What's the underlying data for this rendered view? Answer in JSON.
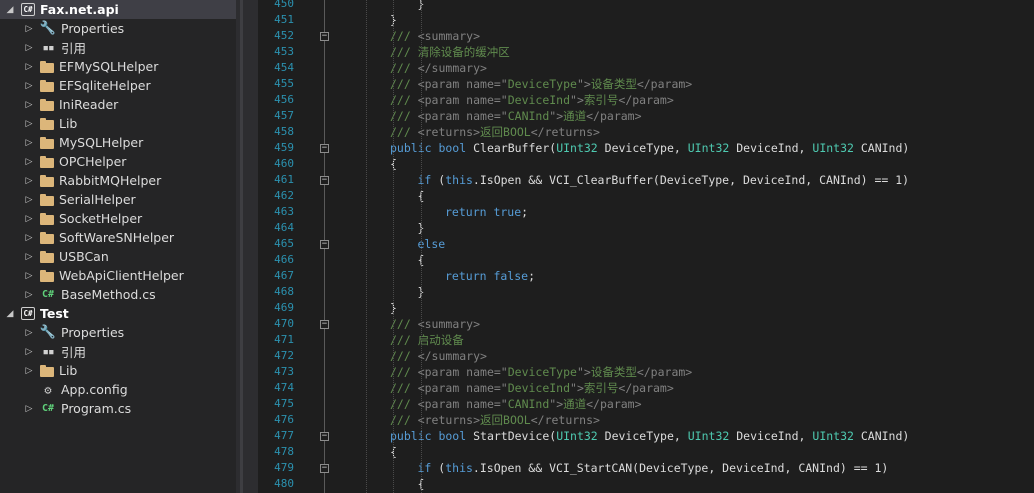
{
  "solution_tree": [
    {
      "label": "Fax.net.api",
      "kind": "project",
      "level": 0,
      "arrow": "open",
      "selected": true
    },
    {
      "label": "Properties",
      "kind": "properties",
      "level": 1,
      "arrow": "closed"
    },
    {
      "label": "引用",
      "kind": "references",
      "level": 1,
      "arrow": "closed"
    },
    {
      "label": "EFMySQLHelper",
      "kind": "folder",
      "level": 1,
      "arrow": "closed"
    },
    {
      "label": "EFSqliteHelper",
      "kind": "folder",
      "level": 1,
      "arrow": "closed"
    },
    {
      "label": "IniReader",
      "kind": "folder",
      "level": 1,
      "arrow": "closed"
    },
    {
      "label": "Lib",
      "kind": "folder",
      "level": 1,
      "arrow": "closed"
    },
    {
      "label": "MySQLHelper",
      "kind": "folder",
      "level": 1,
      "arrow": "closed"
    },
    {
      "label": "OPCHelper",
      "kind": "folder",
      "level": 1,
      "arrow": "closed"
    },
    {
      "label": "RabbitMQHelper",
      "kind": "folder",
      "level": 1,
      "arrow": "closed"
    },
    {
      "label": "SerialHelper",
      "kind": "folder",
      "level": 1,
      "arrow": "closed"
    },
    {
      "label": "SocketHelper",
      "kind": "folder",
      "level": 1,
      "arrow": "closed"
    },
    {
      "label": "SoftWareSNHelper",
      "kind": "folder",
      "level": 1,
      "arrow": "closed"
    },
    {
      "label": "USBCan",
      "kind": "folder",
      "level": 1,
      "arrow": "closed"
    },
    {
      "label": "WebApiClientHelper",
      "kind": "folder",
      "level": 1,
      "arrow": "closed"
    },
    {
      "label": "BaseMethod.cs",
      "kind": "csfile",
      "level": 1,
      "arrow": "closed"
    },
    {
      "label": "Test",
      "kind": "project",
      "level": 0,
      "arrow": "open"
    },
    {
      "label": "Properties",
      "kind": "properties",
      "level": 1,
      "arrow": "closed"
    },
    {
      "label": "引用",
      "kind": "references",
      "level": 1,
      "arrow": "closed"
    },
    {
      "label": "Lib",
      "kind": "folder",
      "level": 1,
      "arrow": "closed"
    },
    {
      "label": "App.config",
      "kind": "config",
      "level": 1,
      "arrow": "none"
    },
    {
      "label": "Program.cs",
      "kind": "csfile",
      "level": 1,
      "arrow": "closed"
    }
  ],
  "icon_names": {
    "project": "csharp-project-icon",
    "properties": "wrench-icon",
    "references": "references-icon",
    "folder": "folder-icon",
    "csfile": "csharp-file-icon",
    "config": "config-file-icon"
  },
  "icon_glyphs": {
    "project": "C#",
    "properties": "🔧",
    "references": "▪▪",
    "folder": "",
    "csfile": "C#",
    "config": "⚙"
  },
  "colors": {
    "line_number": "#2b91af",
    "keyword": "#569cd6",
    "type": "#4ec9b0",
    "comment": "#57a64a",
    "xml_doc_tag": "#808080"
  },
  "editor_lines": [
    {
      "n": "450",
      "indent": 3,
      "tokens": [
        [
          "pl",
          "}"
        ]
      ]
    },
    {
      "n": "451",
      "indent": 2,
      "tokens": [
        [
          "pl",
          "}"
        ]
      ]
    },
    {
      "n": "452",
      "indent": 2,
      "tokens": [
        [
          "dc",
          "/// "
        ],
        [
          "tag",
          "<summary>"
        ]
      ]
    },
    {
      "n": "453",
      "indent": 2,
      "tokens": [
        [
          "dc",
          "/// 清除设备的缓冲区"
        ]
      ]
    },
    {
      "n": "454",
      "indent": 2,
      "tokens": [
        [
          "dc",
          "/// "
        ],
        [
          "tag",
          "</summary>"
        ]
      ]
    },
    {
      "n": "455",
      "indent": 2,
      "tokens": [
        [
          "dc",
          "/// "
        ],
        [
          "tag",
          "<param name=\""
        ],
        [
          "dc",
          "DeviceType"
        ],
        [
          "tag",
          "\">"
        ],
        [
          "dc",
          "设备类型"
        ],
        [
          "tag",
          "</param>"
        ]
      ]
    },
    {
      "n": "456",
      "indent": 2,
      "tokens": [
        [
          "dc",
          "/// "
        ],
        [
          "tag",
          "<param name=\""
        ],
        [
          "dc",
          "DeviceInd"
        ],
        [
          "tag",
          "\">"
        ],
        [
          "dc",
          "索引号"
        ],
        [
          "tag",
          "</param>"
        ]
      ]
    },
    {
      "n": "457",
      "indent": 2,
      "tokens": [
        [
          "dc",
          "/// "
        ],
        [
          "tag",
          "<param name=\""
        ],
        [
          "dc",
          "CANInd"
        ],
        [
          "tag",
          "\">"
        ],
        [
          "dc",
          "通道"
        ],
        [
          "tag",
          "</param>"
        ]
      ]
    },
    {
      "n": "458",
      "indent": 2,
      "tokens": [
        [
          "dc",
          "/// "
        ],
        [
          "tag",
          "<returns>"
        ],
        [
          "dc",
          "返回BOOL"
        ],
        [
          "tag",
          "</returns>"
        ]
      ]
    },
    {
      "n": "459",
      "indent": 2,
      "tokens": [
        [
          "kw",
          "public bool "
        ],
        [
          "pl",
          "ClearBuffer("
        ],
        [
          "ty",
          "UInt32"
        ],
        [
          "pl",
          " DeviceType, "
        ],
        [
          "ty",
          "UInt32"
        ],
        [
          "pl",
          " DeviceInd, "
        ],
        [
          "ty",
          "UInt32"
        ],
        [
          "pl",
          " CANInd)"
        ]
      ]
    },
    {
      "n": "460",
      "indent": 2,
      "tokens": [
        [
          "pl",
          "{"
        ]
      ]
    },
    {
      "n": "461",
      "indent": 3,
      "tokens": [
        [
          "kw",
          "if"
        ],
        [
          "pl",
          " ("
        ],
        [
          "kw",
          "this"
        ],
        [
          "pl",
          ".IsOpen && VCI_ClearBuffer(DeviceType, DeviceInd, CANInd) == 1)"
        ]
      ]
    },
    {
      "n": "462",
      "indent": 3,
      "tokens": [
        [
          "pl",
          "{"
        ]
      ]
    },
    {
      "n": "463",
      "indent": 4,
      "tokens": [
        [
          "kw",
          "return true"
        ],
        [
          "pl",
          ";"
        ]
      ]
    },
    {
      "n": "464",
      "indent": 3,
      "tokens": [
        [
          "pl",
          "}"
        ]
      ]
    },
    {
      "n": "465",
      "indent": 3,
      "tokens": [
        [
          "kw",
          "else"
        ]
      ]
    },
    {
      "n": "466",
      "indent": 3,
      "tokens": [
        [
          "pl",
          "{"
        ]
      ]
    },
    {
      "n": "467",
      "indent": 4,
      "tokens": [
        [
          "kw",
          "return false"
        ],
        [
          "pl",
          ";"
        ]
      ]
    },
    {
      "n": "468",
      "indent": 3,
      "tokens": [
        [
          "pl",
          "}"
        ]
      ]
    },
    {
      "n": "469",
      "indent": 2,
      "tokens": [
        [
          "pl",
          "}"
        ]
      ]
    },
    {
      "n": "470",
      "indent": 2,
      "tokens": [
        [
          "dc",
          "/// "
        ],
        [
          "tag",
          "<summary>"
        ]
      ]
    },
    {
      "n": "471",
      "indent": 2,
      "tokens": [
        [
          "dc",
          "/// 启动设备"
        ]
      ]
    },
    {
      "n": "472",
      "indent": 2,
      "tokens": [
        [
          "dc",
          "/// "
        ],
        [
          "tag",
          "</summary>"
        ]
      ]
    },
    {
      "n": "473",
      "indent": 2,
      "tokens": [
        [
          "dc",
          "/// "
        ],
        [
          "tag",
          "<param name=\""
        ],
        [
          "dc",
          "DeviceType"
        ],
        [
          "tag",
          "\">"
        ],
        [
          "dc",
          "设备类型"
        ],
        [
          "tag",
          "</param>"
        ]
      ]
    },
    {
      "n": "474",
      "indent": 2,
      "tokens": [
        [
          "dc",
          "/// "
        ],
        [
          "tag",
          "<param name=\""
        ],
        [
          "dc",
          "DeviceInd"
        ],
        [
          "tag",
          "\">"
        ],
        [
          "dc",
          "索引号"
        ],
        [
          "tag",
          "</param>"
        ]
      ]
    },
    {
      "n": "475",
      "indent": 2,
      "tokens": [
        [
          "dc",
          "/// "
        ],
        [
          "tag",
          "<param name=\""
        ],
        [
          "dc",
          "CANInd"
        ],
        [
          "tag",
          "\">"
        ],
        [
          "dc",
          "通道"
        ],
        [
          "tag",
          "</param>"
        ]
      ]
    },
    {
      "n": "476",
      "indent": 2,
      "tokens": [
        [
          "dc",
          "/// "
        ],
        [
          "tag",
          "<returns>"
        ],
        [
          "dc",
          "返回BOOL"
        ],
        [
          "tag",
          "</returns>"
        ]
      ]
    },
    {
      "n": "477",
      "indent": 2,
      "tokens": [
        [
          "kw",
          "public bool "
        ],
        [
          "pl",
          "StartDevice("
        ],
        [
          "ty",
          "UInt32"
        ],
        [
          "pl",
          " DeviceType, "
        ],
        [
          "ty",
          "UInt32"
        ],
        [
          "pl",
          " DeviceInd, "
        ],
        [
          "ty",
          "UInt32"
        ],
        [
          "pl",
          " CANInd)"
        ]
      ]
    },
    {
      "n": "478",
      "indent": 2,
      "tokens": [
        [
          "pl",
          "{"
        ]
      ]
    },
    {
      "n": "479",
      "indent": 3,
      "tokens": [
        [
          "kw",
          "if"
        ],
        [
          "pl",
          " ("
        ],
        [
          "kw",
          "this"
        ],
        [
          "pl",
          ".IsOpen && VCI_StartCAN(DeviceType, DeviceInd, CANInd) == 1)"
        ]
      ]
    },
    {
      "n": "480",
      "indent": 3,
      "tokens": [
        [
          "pl",
          "{"
        ]
      ]
    }
  ],
  "fold_markers": [
    {
      "line": "452",
      "sign": "−"
    },
    {
      "line": "459",
      "sign": "−"
    },
    {
      "line": "461",
      "sign": "−"
    },
    {
      "line": "465",
      "sign": "−"
    },
    {
      "line": "470",
      "sign": "−"
    },
    {
      "line": "477",
      "sign": "−"
    },
    {
      "line": "479",
      "sign": "−"
    }
  ]
}
